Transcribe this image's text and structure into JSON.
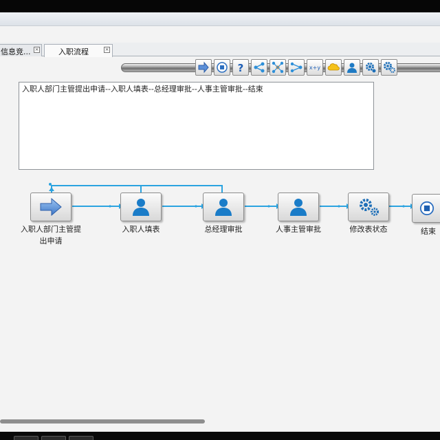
{
  "tabs": [
    {
      "label": "信息竞...",
      "close": "×"
    },
    {
      "label": "入职流程",
      "close": "×"
    }
  ],
  "toolbar": {
    "icons": [
      "arrow-right-icon",
      "stop-icon",
      "help-icon",
      "branch-icon",
      "fork-icon",
      "join-icon",
      "sequence-icon",
      "cloud-icon",
      "user-icon",
      "gear-icon",
      "gears-icon"
    ]
  },
  "description": "入职人部门主管提出申请--入职人填表--总经理审批--人事主管审批--结束",
  "flow": {
    "nodes": [
      {
        "label": "入职人部门主管提\n出申请",
        "line1": "入职人部门主管提",
        "line2": "出申请",
        "icon": "arrow-right-icon"
      },
      {
        "label": "入职人填表",
        "icon": "user-icon"
      },
      {
        "label": "总经理审批",
        "icon": "user-icon"
      },
      {
        "label": "人事主管审批",
        "icon": "user-icon"
      },
      {
        "label": "修改表状态",
        "icon": "gears-icon"
      },
      {
        "label": "结束",
        "icon": "stop-icon"
      }
    ],
    "line_color": "#2aa3e0"
  }
}
